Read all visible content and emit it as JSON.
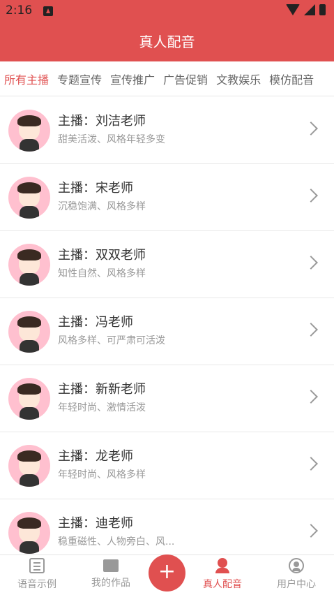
{
  "statusbar": {
    "time": "2:16"
  },
  "header": {
    "title": "真人配音"
  },
  "tabs": [
    {
      "label": "所有主播",
      "active": true
    },
    {
      "label": "专题宣传",
      "active": false
    },
    {
      "label": "宣传推广",
      "active": false
    },
    {
      "label": "广告促销",
      "active": false
    },
    {
      "label": "文教娱乐",
      "active": false
    },
    {
      "label": "模仿配音",
      "active": false
    }
  ],
  "anchors": [
    {
      "name": "主播：刘洁老师",
      "desc": "甜美活泼、风格年轻多变"
    },
    {
      "name": "主播：宋老师",
      "desc": "沉稳饱满、风格多样"
    },
    {
      "name": "主播：双双老师",
      "desc": "知性自然、风格多样"
    },
    {
      "name": "主播：冯老师",
      "desc": "风格多样、可严肃可活泼"
    },
    {
      "name": "主播：新新老师",
      "desc": "年轻时尚、激情活泼"
    },
    {
      "name": "主播：龙老师",
      "desc": "年轻时尚、风格多样"
    },
    {
      "name": "主播：迪老师",
      "desc": "稳重磁性、人物旁白、风..."
    }
  ],
  "bottom_nav": [
    {
      "label": "语音示例",
      "icon": "list-icon"
    },
    {
      "label": "我的作品",
      "icon": "folder-icon"
    },
    {
      "label": "真人配音",
      "icon": "person-icon",
      "active": true
    },
    {
      "label": "用户中心",
      "icon": "user-icon"
    }
  ],
  "fab": {
    "symbol": "+"
  },
  "colors": {
    "accent": "#e05050",
    "avatar_bg": "#ffc0cf"
  }
}
